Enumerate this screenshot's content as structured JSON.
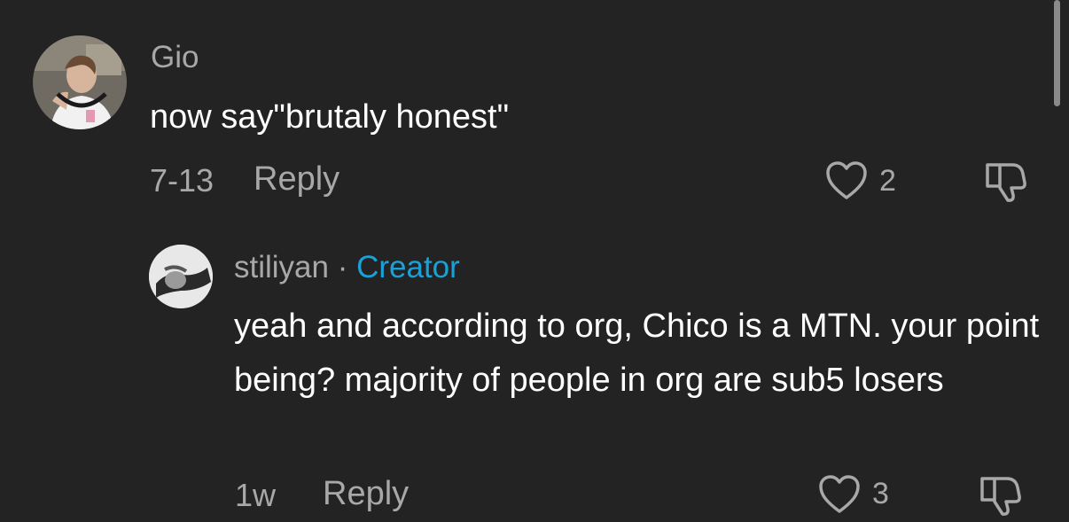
{
  "comments": [
    {
      "username": "Gio",
      "text": "now say\"brutaly honest\"",
      "date": "7-13",
      "reply_label": "Reply",
      "likes": "2",
      "is_creator": false
    },
    {
      "username": "stiliyan",
      "creator_sep": " · ",
      "creator_label": "Creator",
      "text": "yeah and according to org, Chico is a MTN. your point being? majority of people in org are sub5 losers",
      "date": "1w",
      "reply_label": "Reply",
      "likes": "3",
      "is_creator": true
    }
  ],
  "icons": {
    "like": "heart-outline-icon",
    "dislike": "thumbs-down-outline-icon"
  },
  "colors": {
    "background": "#232323",
    "muted_text": "#a8a8a8",
    "creator_accent": "#1ba1d9"
  }
}
